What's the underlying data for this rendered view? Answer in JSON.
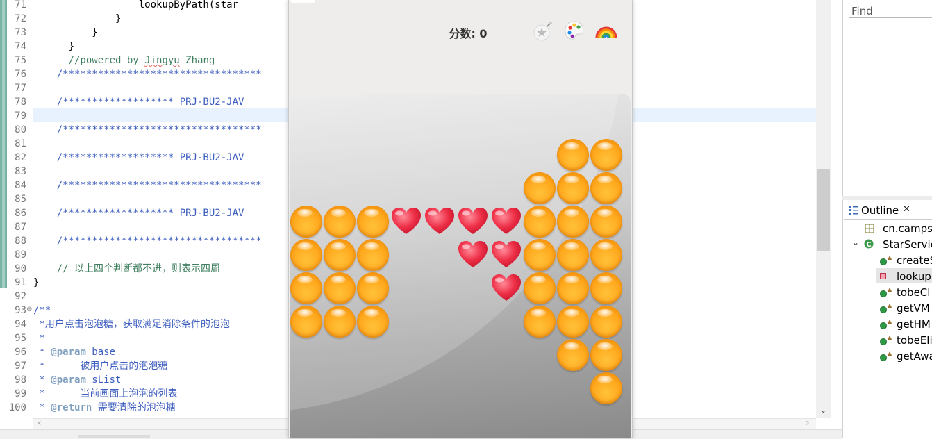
{
  "editor": {
    "line_numbers": [
      "71",
      "72",
      "73",
      "74",
      "75",
      "76",
      "77",
      "78",
      "79",
      "80",
      "81",
      "82",
      "83",
      "84",
      "85",
      "86",
      "87",
      "88",
      "89",
      "90",
      "91",
      "92",
      "93",
      "94",
      "95",
      "96",
      "97",
      "98",
      "99",
      "100"
    ],
    "lines": {
      "l71": "                  lookupByPath(star",
      "l72": "              }",
      "l73": "          }",
      "l74": "      }",
      "l75": "      //powered by ",
      "l75b": "Jingyu",
      "l75c": " Zhang",
      "l76": "    /**********************************",
      "l78": "    /******************* PRJ-BU2-JAV",
      "l80": "    /**********************************",
      "l82": "    /******************* PRJ-BU2-JAV",
      "l84": "    /**********************************",
      "l86": "    /******************* PRJ-BU2-JAV",
      "l88": "    /**********************************",
      "l90": "    // 以上四个判断都不进，则表示四周",
      "l91": "}",
      "l93": "/**",
      "l94": " *用户点击泡泡糖，获取满足消除条件的泡泡",
      "l95": " *",
      "l96a": " * ",
      "l96b": "@param",
      "l96c": " base",
      "l97": " *      被用户点击的泡泡糖",
      "l98a": " * ",
      "l98b": "@param",
      "l98c": " sList",
      "l99": " *      当前画面上泡泡的列表",
      "l100a": " * ",
      "l100b": "@return",
      "l100c": " 需要清除的泡泡糖"
    },
    "fold_marker": "⊖"
  },
  "game": {
    "score_label": "分数: 0",
    "tools": [
      "bomb-icon",
      "palette-icon",
      "rainbow-icon"
    ]
  },
  "right_panel": {
    "find_placeholder": "Find",
    "outline_title": "Outline",
    "outline_close": "✕",
    "items": {
      "package": "cn.campsg",
      "class": "StarServic",
      "m1": "createS",
      "m2": "lookup",
      "m3": "tobeCl",
      "m4": "getVM",
      "m5": "getHM",
      "m6": "tobeEli",
      "m7": "getAwa"
    }
  },
  "colors": {
    "comment_green": "#3f7f5f",
    "javadoc_blue": "#3f5fbf",
    "highlight_line": "#e8f2fe",
    "candy_orange": "#ffaa1f",
    "heart_red": "#e8253c"
  }
}
